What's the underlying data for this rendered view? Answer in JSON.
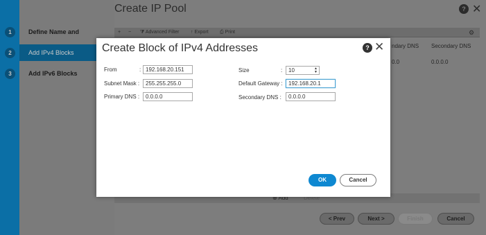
{
  "wizard": {
    "steps": [
      {
        "num": "1",
        "label": "Define Name and Description"
      },
      {
        "num": "2",
        "label": "Add IPv4 Blocks"
      },
      {
        "num": "3",
        "label": "Add IPv6 Blocks"
      }
    ],
    "title": "Create IP Pool",
    "help_icon": "?",
    "toolbar": {
      "add": "+",
      "remove": "−",
      "advanced_filter": "Advanced Filter",
      "export": "Export",
      "print": "Print"
    },
    "columns": {
      "secondary_dns_left": "ndary DNS",
      "secondary_dns": "Secondary DNS"
    },
    "row": {
      "primary_dns_partial": "0.0",
      "secondary_dns": "0.0.0.0"
    },
    "add_bar": {
      "add": "Add",
      "delete": "Delete"
    },
    "buttons": {
      "prev": "< Prev",
      "next": "Next >",
      "finish": "Finish",
      "cancel": "Cancel"
    }
  },
  "dialog": {
    "title": "Create Block of IPv4 Addresses",
    "help_icon": "?",
    "fields": {
      "from_label": "From",
      "from_value": "192.168.20.151",
      "size_label": "Size",
      "size_value": "10",
      "subnet_label": "Subnet Mask :",
      "subnet_value": "255.255.255.0",
      "gateway_label": "Default Gateway :",
      "gateway_value": "192.168.20.1",
      "primary_label": "Primary DNS :",
      "primary_value": "0.0.0.0",
      "secondary_label": "Secondary DNS :",
      "secondary_value": "0.0.0.0"
    },
    "ok": "OK",
    "cancel": "Cancel"
  }
}
